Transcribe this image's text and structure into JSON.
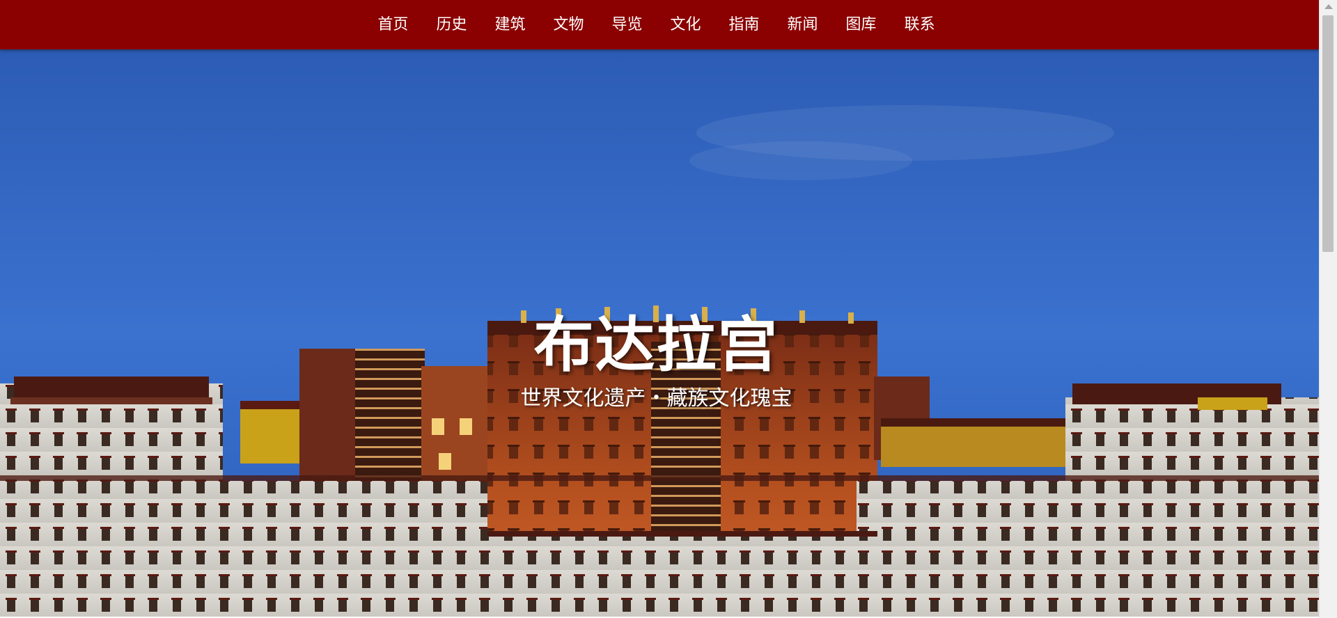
{
  "nav": {
    "items": [
      {
        "label": "首页"
      },
      {
        "label": "历史"
      },
      {
        "label": "建筑"
      },
      {
        "label": "文物"
      },
      {
        "label": "导览"
      },
      {
        "label": "文化"
      },
      {
        "label": "指南"
      },
      {
        "label": "新闻"
      },
      {
        "label": "图库"
      },
      {
        "label": "联系"
      }
    ]
  },
  "hero": {
    "title": "布达拉宫",
    "subtitle": "世界文化遗产・藏族文化瑰宝",
    "image": "potala-palace-night-photo"
  },
  "colors": {
    "nav_bg": "#8b0000",
    "nav_text": "#ffffff",
    "sky": "#3a70cc",
    "red_palace": "#a3461e",
    "white_palace": "#e8e6e0"
  }
}
